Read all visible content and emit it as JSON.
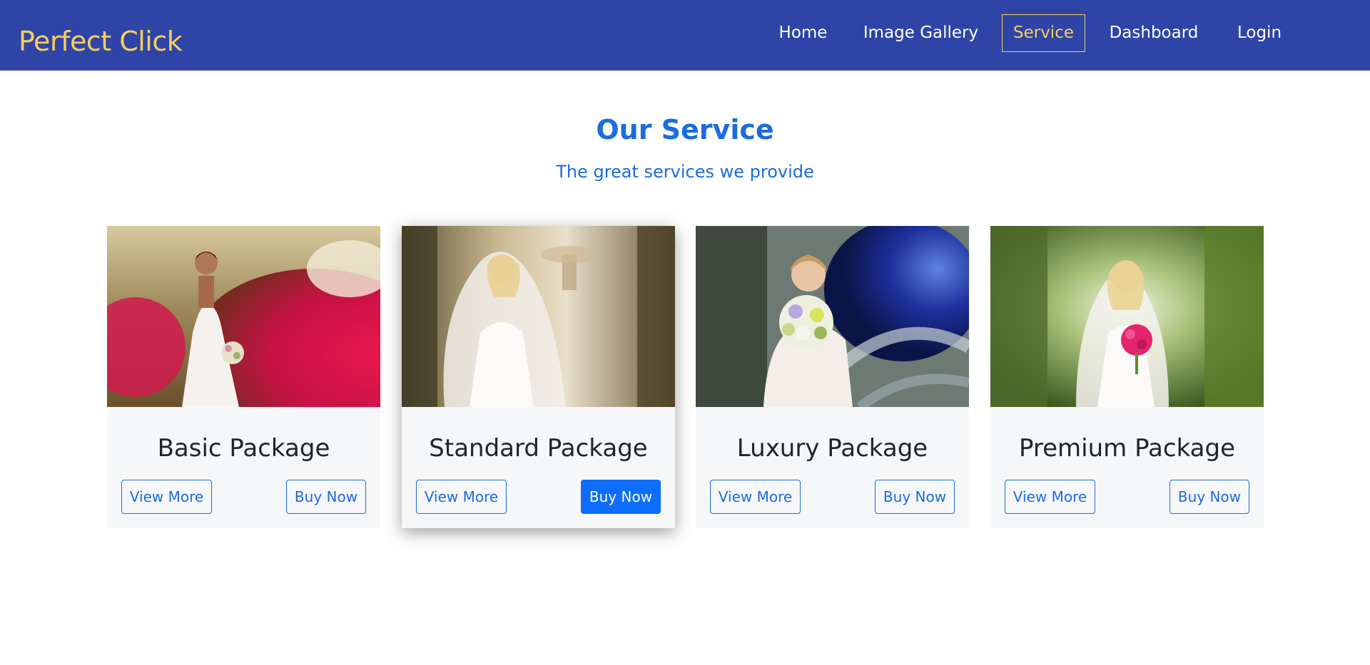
{
  "navbar": {
    "brand": "Perfect Click",
    "links": [
      {
        "label": "Home",
        "active": false
      },
      {
        "label": "Image Gallery",
        "active": false
      },
      {
        "label": "Service",
        "active": true
      },
      {
        "label": "Dashboard",
        "active": false
      },
      {
        "label": "Login",
        "active": false
      }
    ]
  },
  "section": {
    "title": "Our Service",
    "subtitle": "The great services we provide"
  },
  "cards": [
    {
      "title": "Basic Package",
      "view_label": "View More",
      "buy_label": "Buy Now",
      "image": "bride-with-red-azaleas-photo"
    },
    {
      "title": "Standard Package",
      "view_label": "View More",
      "buy_label": "Buy Now",
      "image": "bride-with-veil-photo"
    },
    {
      "title": "Luxury Package",
      "view_label": "View More",
      "buy_label": "Buy Now",
      "image": "bride-with-bouquet-blue-glass-photo"
    },
    {
      "title": "Premium Package",
      "view_label": "View More",
      "buy_label": "Buy Now",
      "image": "bride-in-garden-arch-photo"
    }
  ],
  "colors": {
    "navbar_bg": "#2f44a7",
    "brand": "#f6cf5b",
    "accent": "#1a6ce0",
    "primary_button": "#0d6efd",
    "card_bg": "#f6f7f9"
  }
}
